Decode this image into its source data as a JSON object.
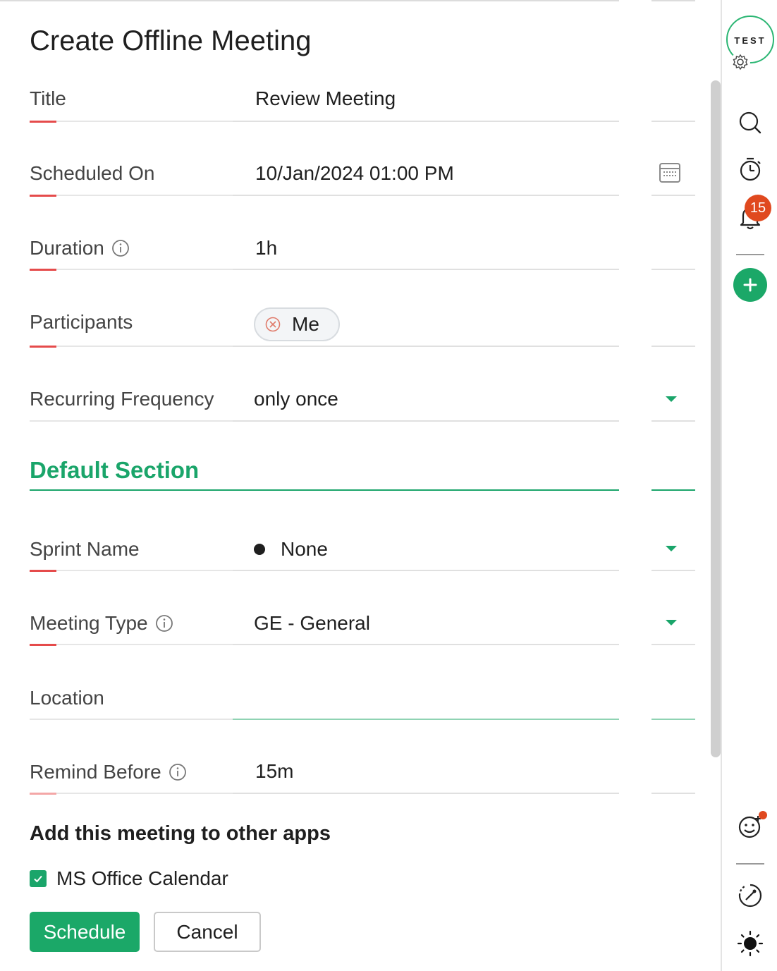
{
  "page": {
    "title": "Create Offline Meeting"
  },
  "fields": {
    "title": {
      "label": "Title",
      "value": "Review Meeting"
    },
    "scheduled_on": {
      "label": "Scheduled On",
      "value": "10/Jan/2024 01:00 PM",
      "icon": "calendar-icon"
    },
    "duration": {
      "label": "Duration",
      "value": "1h",
      "icon": "info-icon"
    },
    "participants": {
      "label": "Participants",
      "chips": [
        "Me"
      ]
    },
    "recurring_frequency": {
      "label": "Recurring Frequency",
      "value": "only once"
    }
  },
  "section": {
    "title": "Default Section",
    "fields": {
      "sprint_name": {
        "label": "Sprint Name",
        "value": "None"
      },
      "meeting_type": {
        "label": "Meeting Type",
        "value": "GE - General",
        "icon": "info-icon"
      },
      "location": {
        "label": "Location",
        "value": ""
      },
      "remind_before": {
        "label": "Remind Before",
        "value": "15m",
        "icon": "info-icon"
      }
    }
  },
  "apps": {
    "title": "Add this meeting to other apps",
    "ms_office_calendar": {
      "label": "MS Office Calendar",
      "checked": true
    }
  },
  "actions": {
    "schedule": "Schedule",
    "cancel": "Cancel"
  },
  "rail": {
    "avatar_text": "TEST",
    "notification_count": "15",
    "icons": [
      "gear-icon",
      "search-icon",
      "timer-icon",
      "bell-icon",
      "add-icon",
      "emoji-icon",
      "link-icon",
      "theme-icon"
    ]
  },
  "colors": {
    "accent": "#1ba868",
    "required_mark": "#e54b4b",
    "badge": "#e0491f"
  }
}
